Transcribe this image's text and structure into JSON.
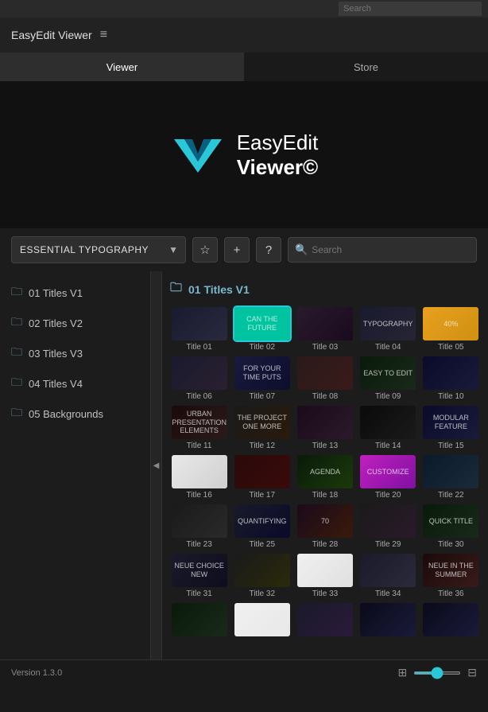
{
  "topbar": {
    "search_placeholder": "Search"
  },
  "titlebar": {
    "app_name": "EasyEdit Viewer",
    "menu_icon": "≡"
  },
  "tabs": [
    {
      "label": "Viewer",
      "active": true
    },
    {
      "label": "Store",
      "active": false
    }
  ],
  "hero": {
    "logo_line1": "EasyEdit",
    "logo_line2": "Viewer©"
  },
  "toolbar": {
    "category_label": "ESSENTIAL TYPOGRAPHY",
    "star_icon": "☆",
    "add_icon": "+",
    "help_icon": "?",
    "search_placeholder": "Search"
  },
  "sidebar": {
    "folder_icon": "📁",
    "header": "01 Titles V1",
    "items": [
      {
        "label": "01 Titles V1"
      },
      {
        "label": "02 Titles V2"
      },
      {
        "label": "03 Titles V3"
      },
      {
        "label": "04 Titles V4"
      },
      {
        "label": "05 Backgrounds"
      }
    ]
  },
  "content": {
    "header": "01 Titles V1",
    "thumbnails": [
      {
        "id": "t01",
        "label": "Title 01",
        "style": "t1",
        "text": ""
      },
      {
        "id": "t02",
        "label": "Title 02",
        "style": "t2",
        "text": "CAN THE\nFUTURE"
      },
      {
        "id": "t03",
        "label": "Title 03",
        "style": "t3",
        "text": ""
      },
      {
        "id": "t04",
        "label": "Title 04",
        "style": "t4",
        "text": "TYPOGRAPHY"
      },
      {
        "id": "t05",
        "label": "Title 05",
        "style": "t5",
        "text": "40%"
      },
      {
        "id": "t06",
        "label": "Title 06",
        "style": "t6",
        "text": ""
      },
      {
        "id": "t07",
        "label": "Title 07",
        "style": "t7",
        "text": "FOR YOUR\nTIME PUTS"
      },
      {
        "id": "t08",
        "label": "Title 08",
        "style": "t8",
        "text": ""
      },
      {
        "id": "t09",
        "label": "Title 09",
        "style": "t9",
        "text": "EASY TO EDIT"
      },
      {
        "id": "t10",
        "label": "Title 10",
        "style": "t10",
        "text": ""
      },
      {
        "id": "t11",
        "label": "Title 11",
        "style": "t11",
        "text": "URBAN PRESENTATION\nELEMENTS"
      },
      {
        "id": "t12",
        "label": "Title 12",
        "style": "t12",
        "text": "THE PROJECT\nONE MORE"
      },
      {
        "id": "t13",
        "label": "Title 13",
        "style": "t13",
        "text": ""
      },
      {
        "id": "t14",
        "label": "Title 14",
        "style": "t14",
        "text": ""
      },
      {
        "id": "t15",
        "label": "Title 15",
        "style": "t15",
        "text": "MODULAR\nFEATURE"
      },
      {
        "id": "t16",
        "label": "Title 16",
        "style": "t16",
        "text": ""
      },
      {
        "id": "t17",
        "label": "Title 17",
        "style": "t17",
        "text": ""
      },
      {
        "id": "t18",
        "label": "Title 18",
        "style": "t18",
        "text": "AGENDA"
      },
      {
        "id": "t20",
        "label": "Title 20",
        "style": "t20",
        "text": "CUSTOMIZE"
      },
      {
        "id": "t22",
        "label": "Title 22",
        "style": "t22",
        "text": ""
      },
      {
        "id": "t23",
        "label": "Title 23",
        "style": "t23",
        "text": ""
      },
      {
        "id": "t25",
        "label": "Title 25",
        "style": "t25",
        "text": "QUANTIFYING"
      },
      {
        "id": "t28",
        "label": "Title 28",
        "style": "t28",
        "text": "70"
      },
      {
        "id": "t29",
        "label": "Title 29",
        "style": "t29",
        "text": ""
      },
      {
        "id": "t30",
        "label": "Title 30",
        "style": "t30",
        "text": "QUICK\nTITLE"
      },
      {
        "id": "t31",
        "label": "Title 31",
        "style": "t31",
        "text": "NEUE CHOICE\nNEW"
      },
      {
        "id": "t32",
        "label": "Title 32",
        "style": "t32",
        "text": ""
      },
      {
        "id": "t33",
        "label": "Title 33",
        "style": "t33",
        "text": ""
      },
      {
        "id": "t34",
        "label": "Title 34",
        "style": "t34",
        "text": ""
      },
      {
        "id": "t36",
        "label": "Title 36",
        "style": "t36",
        "text": "NEUE IN THE\nSUMMER"
      },
      {
        "id": "t37",
        "label": "",
        "style": "t37",
        "text": ""
      },
      {
        "id": "t38",
        "label": "",
        "style": "t38",
        "text": ""
      },
      {
        "id": "t39",
        "label": "",
        "style": "t39",
        "text": ""
      },
      {
        "id": "t40",
        "label": "",
        "style": "t40",
        "text": ""
      },
      {
        "id": "t41",
        "label": "",
        "style": "t40",
        "text": ""
      }
    ]
  },
  "bottombar": {
    "version": "Version 1.3.0",
    "grid_icon": "⊞",
    "list_icon": "⊟",
    "slider_value": 50
  }
}
